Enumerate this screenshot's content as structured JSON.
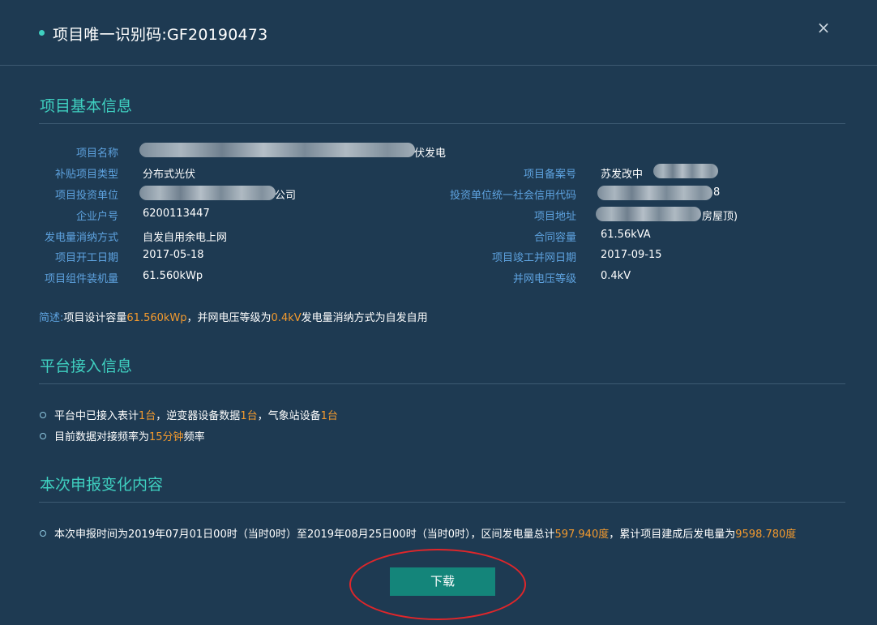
{
  "header": {
    "title": "项目唯一识别码:GF20190473",
    "close_symbol": "×"
  },
  "basic": {
    "title": "项目基本信息",
    "left": [
      {
        "label": "项目名称",
        "value": "伏发电"
      },
      {
        "label": "补贴项目类型",
        "value": "分布式光伏"
      },
      {
        "label": "项目投资单位",
        "value": "公司"
      },
      {
        "label": "企业户号",
        "value": "6200113447"
      },
      {
        "label": "发电量消纳方式",
        "value": "自发自用余电上网"
      },
      {
        "label": "项目开工日期",
        "value": "2017-05-18"
      },
      {
        "label": "项目组件装机量",
        "value": "61.560kWp"
      }
    ],
    "right": [
      {
        "label": "项目备案号",
        "value": "苏发改中"
      },
      {
        "label": "投资单位统一社会信用代码",
        "value": "8"
      },
      {
        "label": "项目地址",
        "value": "房屋顶)"
      },
      {
        "label": "合同容量",
        "value": "61.56kVA"
      },
      {
        "label": "项目竣工并网日期",
        "value": "2017-09-15"
      },
      {
        "label": "并网电压等级",
        "value": "0.4kV"
      }
    ],
    "desc": {
      "prefix": "简述:",
      "p1": "项目设计容量",
      "capacity": "61.560kWp",
      "p2": "，并网电压等级为",
      "voltage": "0.4kV",
      "p3": "发电量消纳方式为自发自用"
    }
  },
  "platform": {
    "title": "平台接入信息",
    "line1": {
      "a": "平台中已接入表计",
      "meters": "1台",
      "b": "，逆变器设备数据",
      "inverters": "1台",
      "c": "，气象站设备",
      "stations": "1台"
    },
    "line2": {
      "a": "目前数据对接频率为",
      "freq": "15分钟",
      "b": "频率"
    }
  },
  "report": {
    "title": "本次申报变化内容",
    "line": {
      "a": "本次申报时间为2019年07月01日00时（当时0时）至2019年08月25日00时（当时0时），区间发电量总计",
      "interval": "597.940度",
      "b": "，累计项目建成后发电量为",
      "total": "9598.780度"
    }
  },
  "download_label": "下载",
  "colors": {
    "background": "#1e3a52",
    "accent": "#3fd0c0",
    "label": "#5ea3e0",
    "highlight": "#f39a2e",
    "button": "#14857a",
    "annotation": "#e0262a"
  }
}
